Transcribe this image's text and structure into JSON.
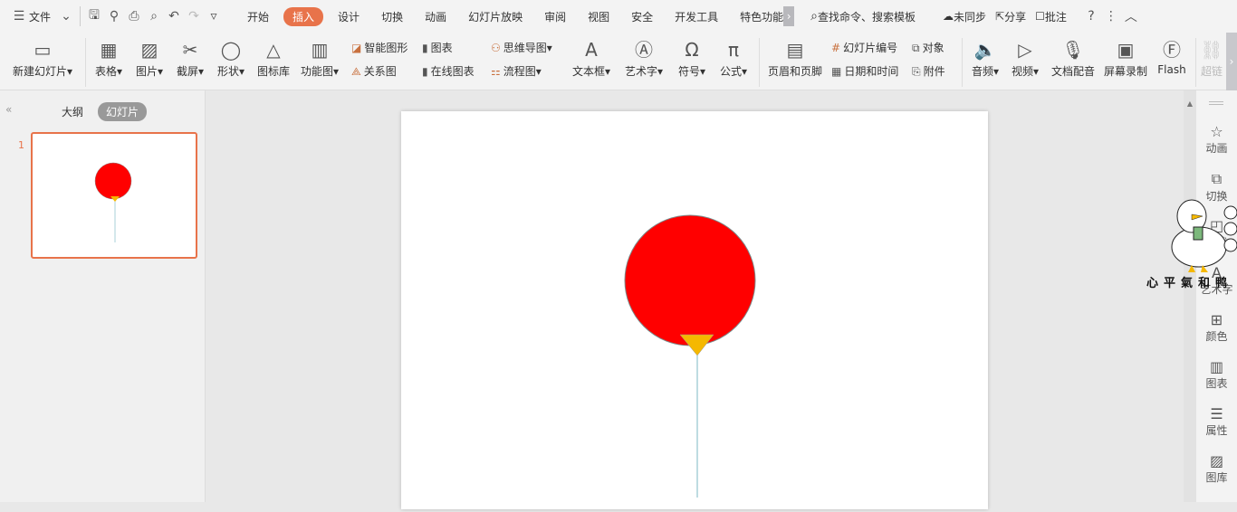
{
  "menu": {
    "file": "文件",
    "tabs": [
      "开始",
      "插入",
      "设计",
      "切换",
      "动画",
      "幻灯片放映",
      "审阅",
      "视图",
      "安全",
      "开发工具",
      "特色功能"
    ],
    "active_tab": "插入",
    "search": "查找命令、搜索模板",
    "sync": "未同步",
    "share": "分享",
    "comment": "批注"
  },
  "ribbon": {
    "new_slide": "新建幻灯片",
    "table": "表格",
    "picture": "图片",
    "screenshot": "截屏",
    "shape": "形状",
    "icon_lib": "图标库",
    "func_chart": "功能图",
    "smart_art": "智能图形",
    "relation": "关系图",
    "chart": "图表",
    "online_chart": "在线图表",
    "mind_map": "思维导图",
    "flowchart": "流程图",
    "textbox": "文本框",
    "art_text": "艺术字",
    "symbol": "符号",
    "formula": "公式",
    "header_footer": "页眉和页脚",
    "slide_number": "幻灯片编号",
    "date_time": "日期和时间",
    "object": "对象",
    "attachment": "附件",
    "audio": "音频",
    "video": "视频",
    "doc_voice": "文档配音",
    "screen_record": "屏幕录制",
    "flash": "Flash",
    "hyperlink": "超链"
  },
  "left_panel": {
    "outline": "大纲",
    "slides": "幻灯片",
    "slide_number": "1"
  },
  "right_panel": [
    "动画",
    "切换",
    "形状",
    "艺术字",
    "颜色",
    "图表",
    "属性",
    "图库"
  ],
  "sticker": "心平氣和鸭",
  "colors": {
    "accent": "#e8734a",
    "balloon": "#ff0000",
    "knot": "#f5b800",
    "string": "#a8d0d8"
  }
}
